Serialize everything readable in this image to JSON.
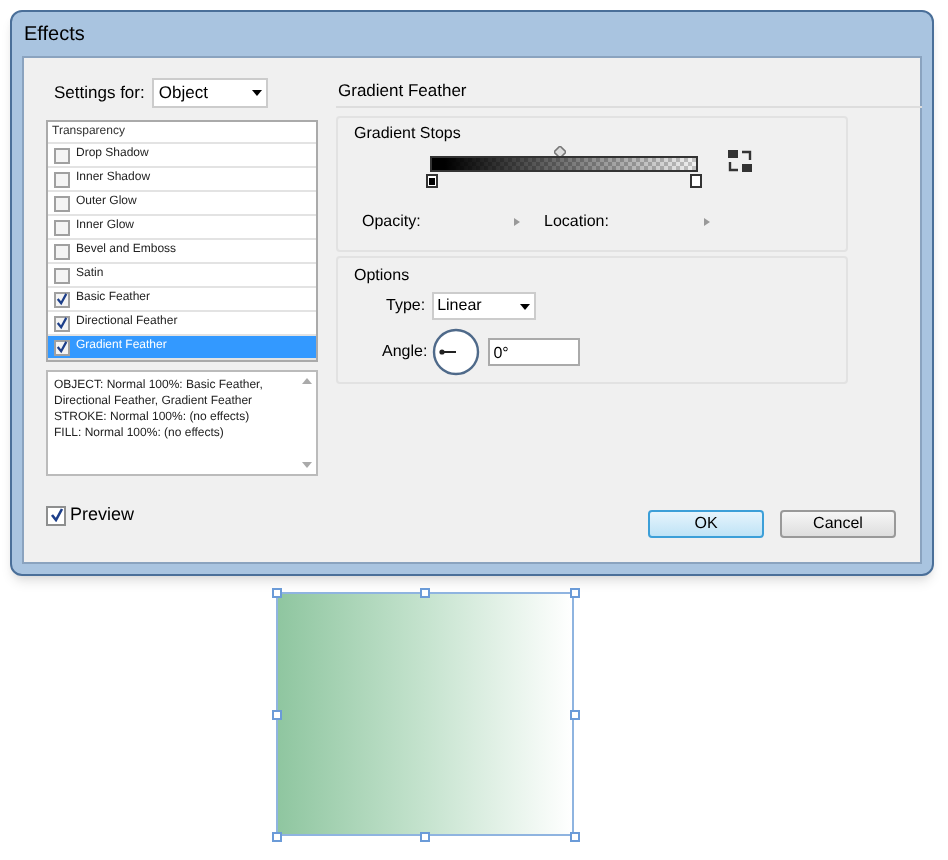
{
  "window": {
    "title": "Effects"
  },
  "settings_for": {
    "label": "Settings for:",
    "value": "Object"
  },
  "effects_list": {
    "header": "Transparency",
    "items": [
      {
        "label": "Drop Shadow",
        "checked": false,
        "selected": false
      },
      {
        "label": "Inner Shadow",
        "checked": false,
        "selected": false
      },
      {
        "label": "Outer Glow",
        "checked": false,
        "selected": false
      },
      {
        "label": "Inner Glow",
        "checked": false,
        "selected": false
      },
      {
        "label": "Bevel and Emboss",
        "checked": false,
        "selected": false
      },
      {
        "label": "Satin",
        "checked": false,
        "selected": false
      },
      {
        "label": "Basic Feather",
        "checked": true,
        "selected": false
      },
      {
        "label": "Directional Feather",
        "checked": true,
        "selected": false
      },
      {
        "label": "Gradient Feather",
        "checked": true,
        "selected": true
      }
    ]
  },
  "summary": [
    "OBJECT: Normal 100%: Basic Feather, Directional Feather, Gradient Feather",
    "STROKE: Normal 100%: (no effects)",
    "FILL: Normal 100%: (no effects)"
  ],
  "preview": {
    "label": "Preview",
    "checked": true
  },
  "panel": {
    "title": "Gradient Feather",
    "gradient_stops": {
      "title": "Gradient Stops",
      "opacity_label": "Opacity:",
      "location_label": "Location:"
    },
    "options": {
      "title": "Options",
      "type_label": "Type:",
      "type_value": "Linear",
      "angle_label": "Angle:",
      "angle_value": "0°"
    }
  },
  "buttons": [
    {
      "label": "OK",
      "default": true
    },
    {
      "label": "Cancel",
      "default": false
    }
  ]
}
